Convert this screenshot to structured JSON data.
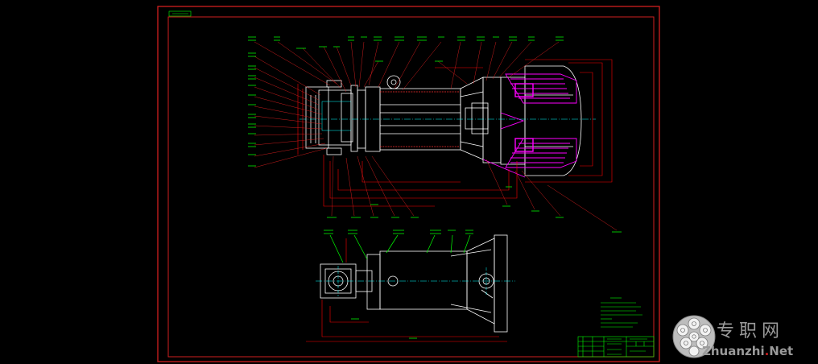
{
  "drawing": {
    "type": "CAD assembly drawing",
    "colors": {
      "background": "#000000",
      "frame": "#d02020",
      "outline": "#ffffff",
      "annotation": "#00ff00",
      "centerline": "#00ffff",
      "hatch": "#ff00ff",
      "dimension": "#ff0000"
    }
  },
  "watermark": {
    "chinese": "专职网",
    "brand": "Zhuanzhi",
    "dot": ".",
    "tld": "Net"
  },
  "icons": {
    "logo": "spiky-sphere-logo"
  }
}
